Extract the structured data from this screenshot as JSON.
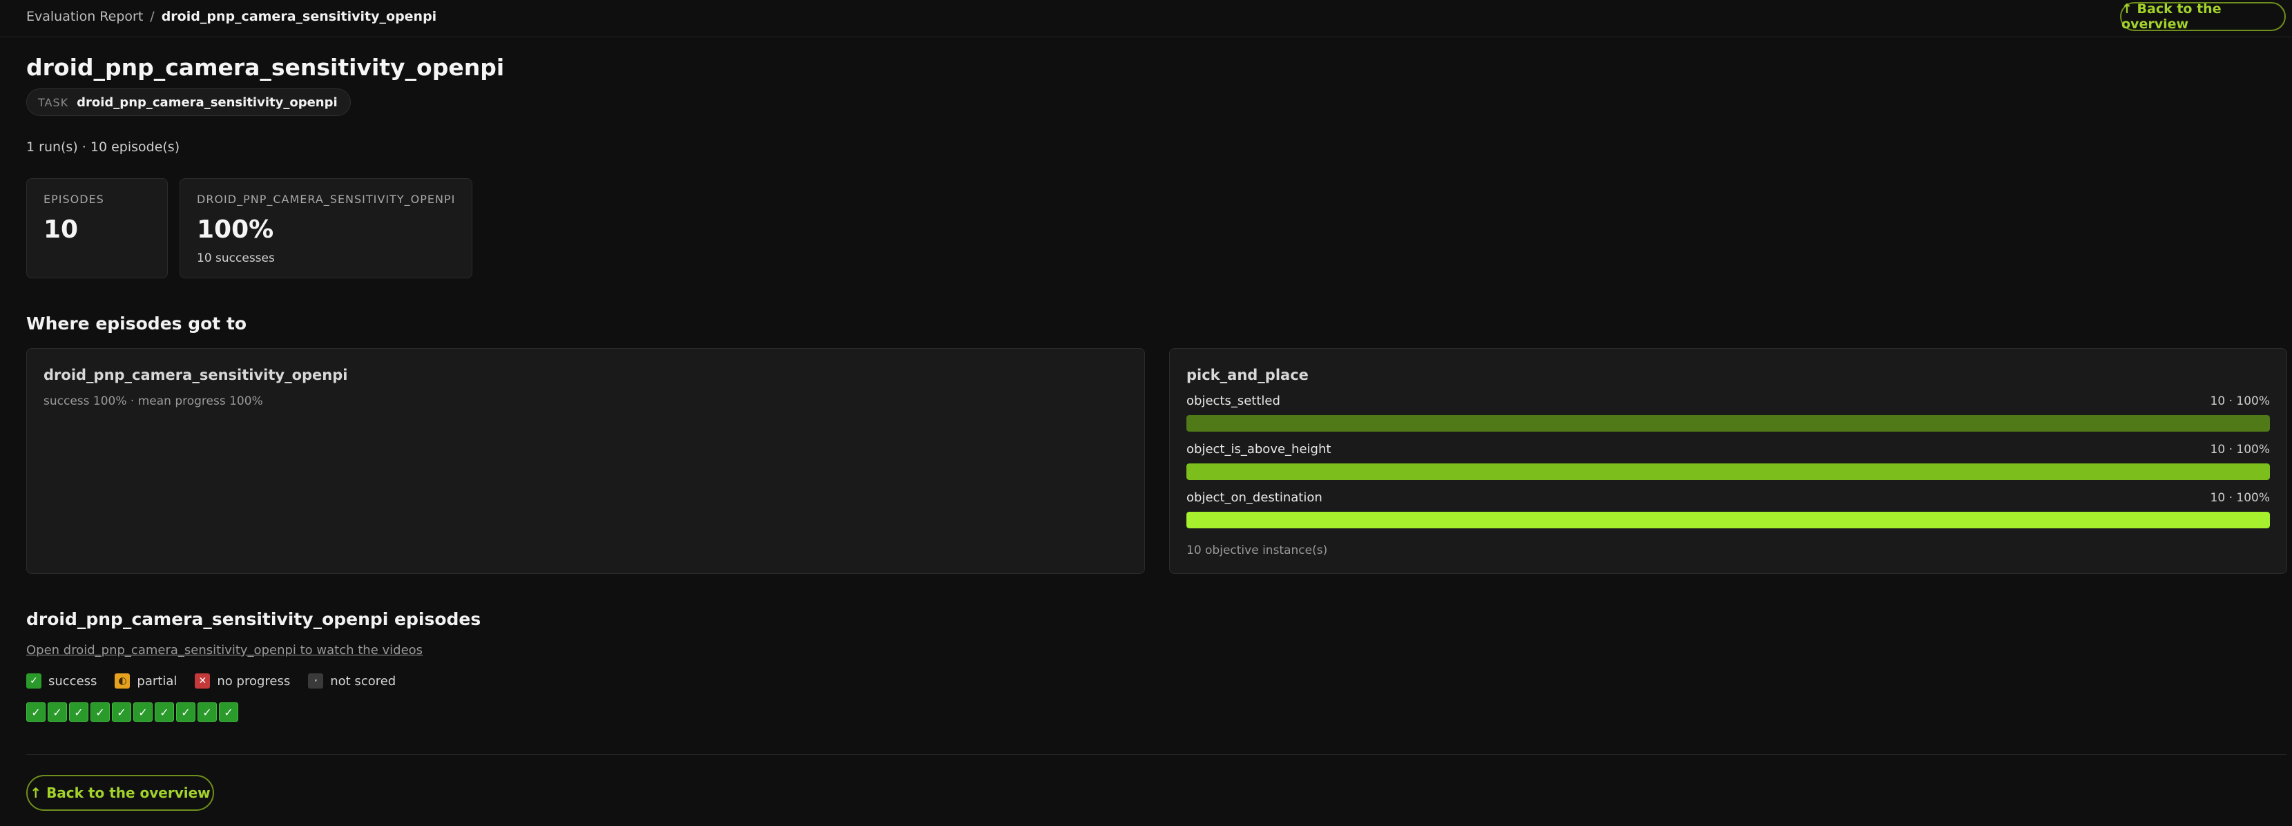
{
  "breadcrumb": {
    "root": "Evaluation Report",
    "separator": "/",
    "current": "droid_pnp_camera_sensitivity_openpi"
  },
  "nav": {
    "back_label": "↑ Back to the overview"
  },
  "header": {
    "title": "droid_pnp_camera_sensitivity_openpi",
    "task_label": "TASK",
    "task_value": "droid_pnp_camera_sensitivity_openpi",
    "runs_summary": "1 run(s) · 10 episode(s)"
  },
  "stats": [
    {
      "label": "EPISODES",
      "value": "10",
      "sub": ""
    },
    {
      "label": "DROID_PNP_CAMERA_SENSITIVITY_OPENPI",
      "value": "100%",
      "sub": "10 successes"
    }
  ],
  "progress_section": {
    "title": "Where episodes got to",
    "left_panel": {
      "title": "droid_pnp_camera_sensitivity_openpi",
      "summary": "success 100% · mean progress 100%"
    },
    "right_panel": {
      "title": "pick_and_place",
      "objectives": [
        {
          "name": "objects_settled",
          "count": "10 · 100%",
          "fraction": 1.0,
          "color": "#4f7a17"
        },
        {
          "name": "object_is_above_height",
          "count": "10 · 100%",
          "fraction": 1.0,
          "color": "#7cbf1c"
        },
        {
          "name": "object_on_destination",
          "count": "10 · 100%",
          "fraction": 1.0,
          "color": "#a6f02e"
        }
      ],
      "footer": "10 objective instance(s)"
    }
  },
  "episodes_section": {
    "title": "droid_pnp_camera_sensitivity_openpi episodes",
    "link": "Open droid_pnp_camera_sensitivity_openpi to watch the videos",
    "legend": [
      {
        "key": "success",
        "glyph": "✓",
        "label": "success"
      },
      {
        "key": "partial",
        "glyph": "◐",
        "label": "partial"
      },
      {
        "key": "noprog",
        "glyph": "✕",
        "label": "no progress"
      },
      {
        "key": "notscored",
        "glyph": "·",
        "label": "not scored"
      }
    ],
    "episode_glyph": "✓",
    "episodes": [
      "success",
      "success",
      "success",
      "success",
      "success",
      "success",
      "success",
      "success",
      "success",
      "success"
    ]
  },
  "colors": {
    "accent": "#a3d32a",
    "success": "#2a9a2a",
    "partial": "#e6a21e",
    "no_progress": "#c43a3a"
  }
}
